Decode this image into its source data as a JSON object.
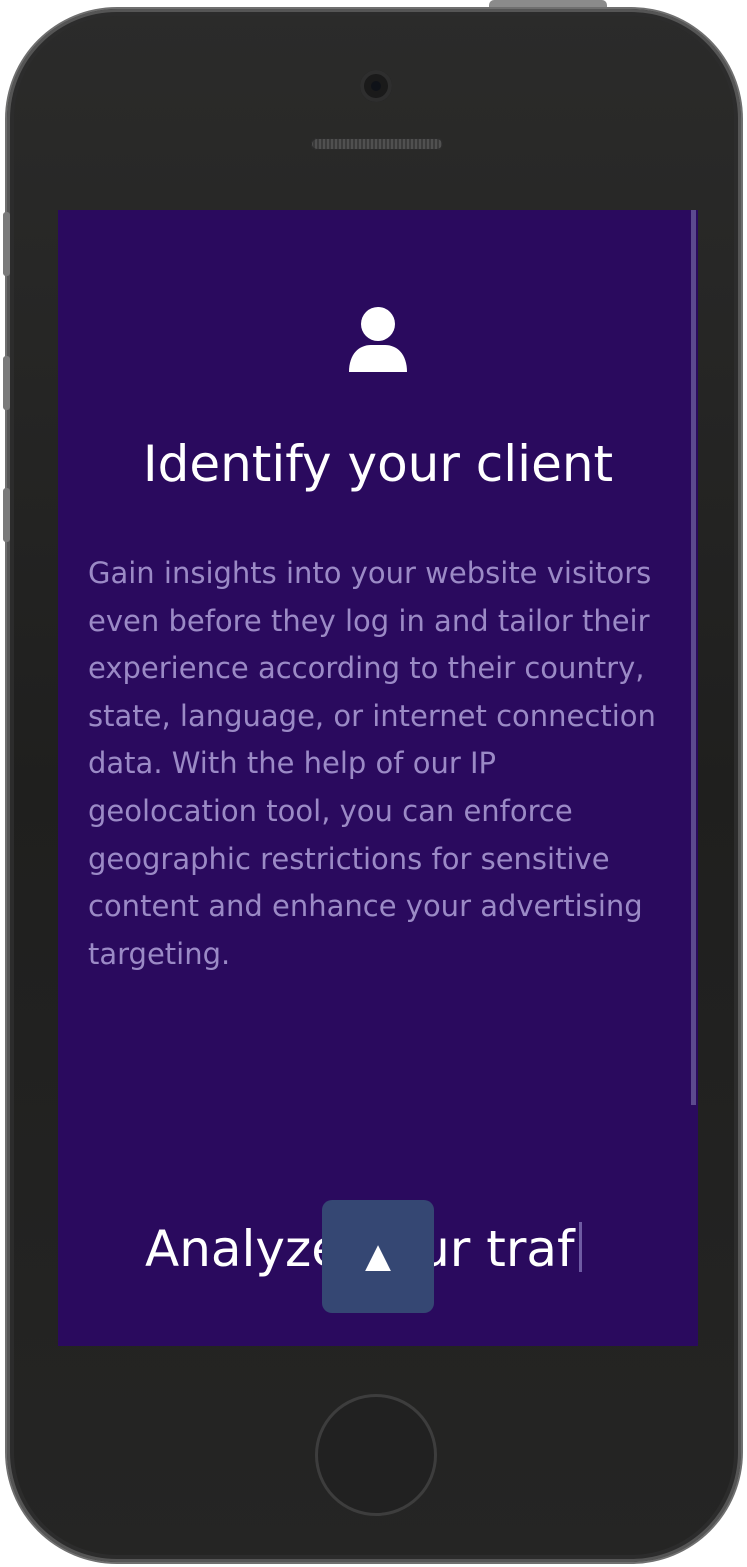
{
  "screen": {
    "feature": {
      "icon": "user-icon",
      "title": "Identify your client",
      "description": "Gain insights into your website visitors even before they log in and tailor their experience according to their country, state, language, or internet connection data. With the help of our IP geolocation tool, you can enforce geographic restrictions for sensitive content and enhance your advertising targeting."
    },
    "typing_heading": {
      "text": "Analyze your traf"
    },
    "scroll_top_button": {
      "icon": "arrow-up-icon",
      "glyph": "▲"
    }
  },
  "colors": {
    "background": "#2a0a5e",
    "title": "#ffffff",
    "description": "#9b8ac6",
    "button": "#354773"
  }
}
